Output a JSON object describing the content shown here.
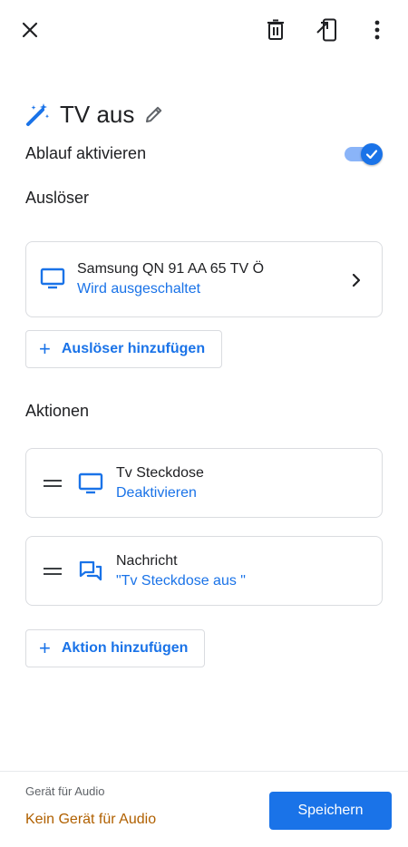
{
  "title": "TV aus",
  "enable": {
    "label": "Ablauf aktivieren",
    "on": true
  },
  "triggers": {
    "heading": "Auslöser",
    "items": [
      {
        "device": "Samsung QN 91 AA 65 TV Ö",
        "state": "Wird ausgeschaltet",
        "icon": "tv-icon"
      }
    ],
    "add_label": "Auslöser hinzufügen"
  },
  "actions": {
    "heading": "Aktionen",
    "items": [
      {
        "name": "Tv Steckdose",
        "detail": "Deaktivieren",
        "icon": "tv-icon"
      },
      {
        "name": "Nachricht",
        "detail": "\"Tv Steckdose aus \"",
        "icon": "chat-bubbles-icon"
      }
    ],
    "add_label": "Aktion hinzufügen"
  },
  "footer": {
    "audio_label": "Gerät für Audio",
    "audio_value": "Kein Gerät für Audio",
    "save_label": "Speichern"
  },
  "colors": {
    "accent": "#1a73e8",
    "warning": "#b06000"
  }
}
